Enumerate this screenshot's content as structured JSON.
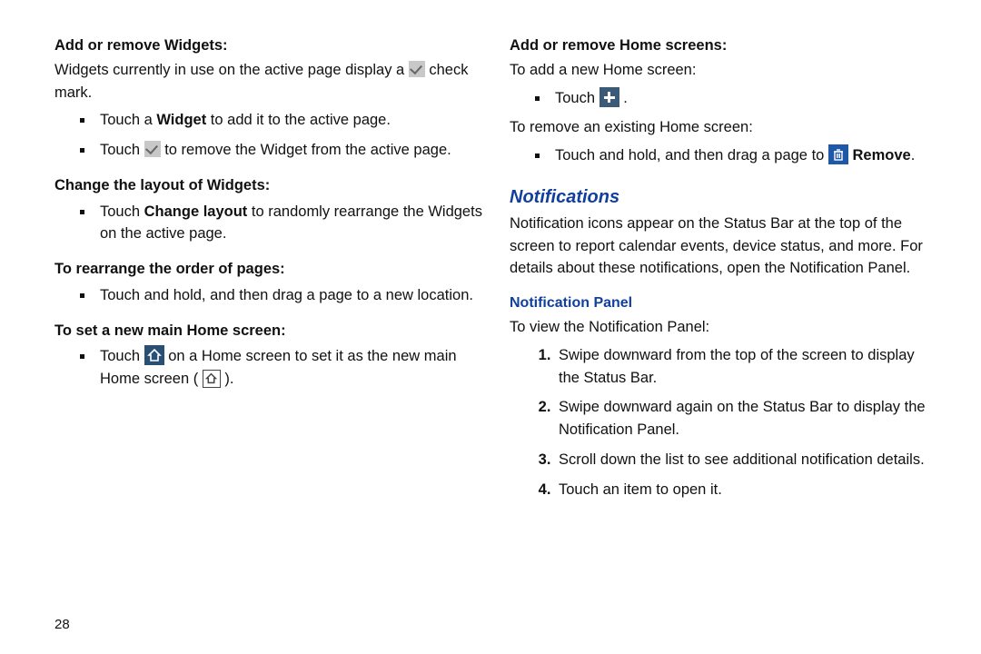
{
  "pageNumber": "28",
  "left": {
    "widgets": {
      "heading": "Add or remove Widgets:",
      "intro_a": "Widgets currently in use on the active page display a ",
      "intro_b": " check mark.",
      "bullet1_a": "Touch a ",
      "bullet1_bold": "Widget",
      "bullet1_b": " to add it to the active page.",
      "bullet2_a": "Touch ",
      "bullet2_b": " to remove the Widget from the active page."
    },
    "layout": {
      "heading": "Change the layout of Widgets:",
      "bullet_a": "Touch ",
      "bullet_bold": "Change layout",
      "bullet_b": " to randomly rearrange the Widgets on the active page."
    },
    "rearrange": {
      "heading": "To rearrange the order of pages:",
      "bullet": "Touch and hold, and then drag a page to a new location."
    },
    "mainhome": {
      "heading": "To set a new main Home screen:",
      "bullet_a": "Touch ",
      "bullet_b": " on a Home screen to set it as the new main Home screen ( ",
      "bullet_c": " )."
    }
  },
  "right": {
    "homescreens": {
      "heading": "Add or remove Home screens:",
      "addLine": "To add a new Home screen:",
      "addBullet_a": "Touch ",
      "addBullet_b": " .",
      "removeLine": "To remove an existing Home screen:",
      "removeBullet_a": "Touch and hold, and then drag a page to ",
      "removeBullet_bold": "Remove",
      "removeBullet_b": "."
    },
    "notifications": {
      "heading": "Notifications",
      "para": "Notification icons appear on the Status Bar at the top of the screen to report calendar events, device status, and more. For details about these notifications, open the Notification Panel."
    },
    "panel": {
      "heading": "Notification Panel",
      "intro": "To view the Notification Panel:",
      "steps": [
        "Swipe downward from the top of the screen to display the Status Bar.",
        "Swipe downward again on the Status Bar to display the Notification Panel.",
        "Scroll down the list to see additional notification details.",
        "Touch an item to open it."
      ]
    }
  }
}
